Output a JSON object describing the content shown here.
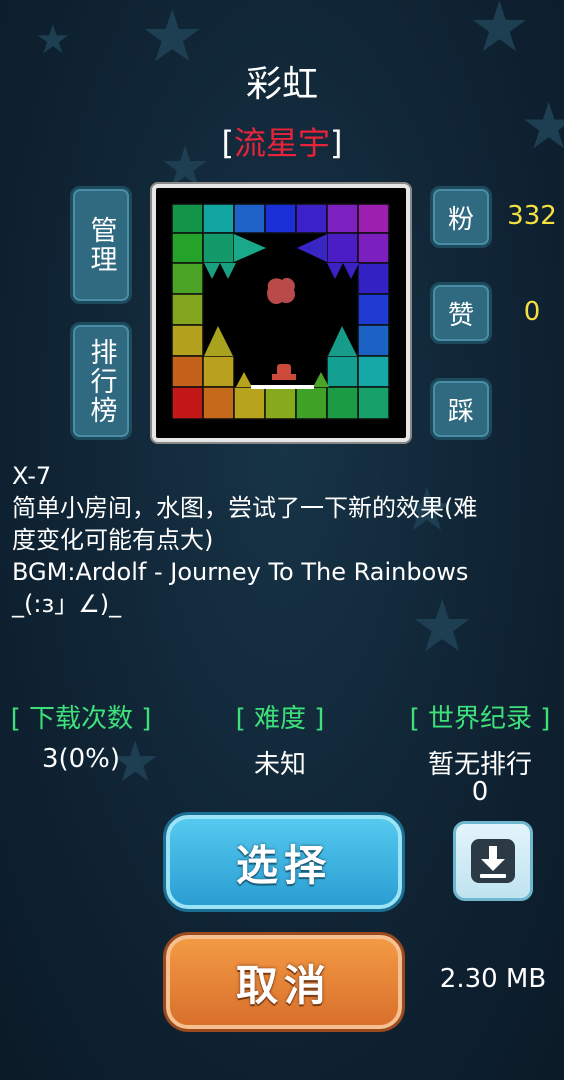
{
  "level": {
    "title": "彩虹",
    "author_open": "[",
    "author_name": "流星宇",
    "author_close": "]"
  },
  "side_buttons": {
    "manage": "管理",
    "ranking": "排行榜"
  },
  "stats": {
    "fans_label": "粉",
    "fans_value": "332",
    "likes_label": "赞",
    "likes_value": "0",
    "dislike_label": "踩"
  },
  "description": [
    "X-7",
    "简单小房间，水图，尝试了一下新的效果(难",
    "度变化可能有点大)",
    "BGM:Ardolf - Journey To The Rainbows",
    "_(:з」∠)_"
  ],
  "info": {
    "downloads_label": "[ 下载次数 ]",
    "downloads_value": "3(0%)",
    "difficulty_label": "[ 难度 ]",
    "difficulty_value": "未知",
    "record_label": "[ 世界纪录 ]",
    "record_value_line1": "暂无排行",
    "record_value_line2": "0"
  },
  "actions": {
    "select": "选择",
    "cancel": "取消",
    "download_icon": "download-icon",
    "file_size": "2.30 MB"
  },
  "colors": {
    "background": "#0f2333",
    "author": "#e8243a",
    "stat_value": "#f5e042",
    "info_label": "#3ee07a",
    "select_button": "#2a9ed2",
    "cancel_button": "#d9702c"
  }
}
